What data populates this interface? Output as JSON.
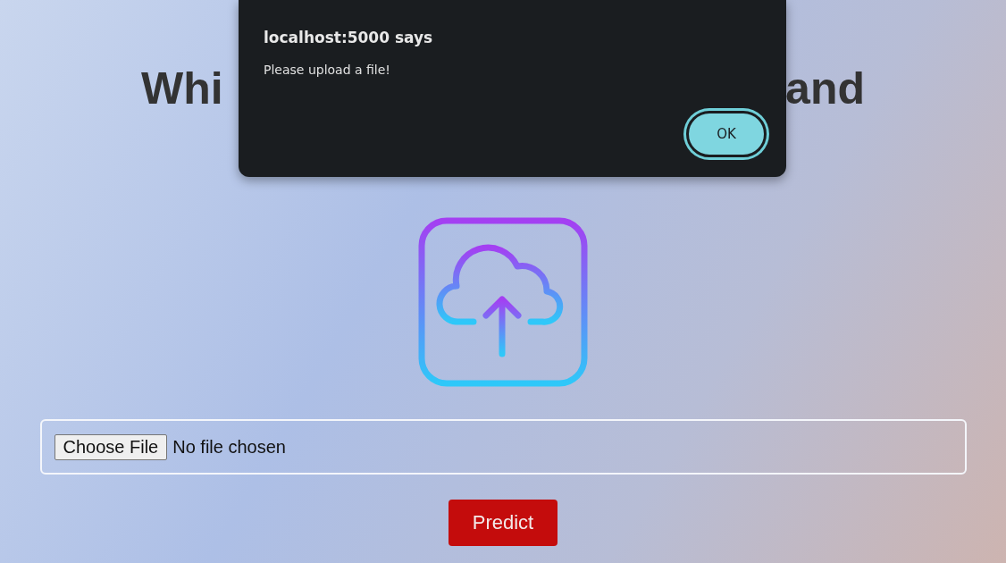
{
  "heading": {
    "left_part": "Whi",
    "right_part": "and"
  },
  "dialog": {
    "title": "localhost:5000 says",
    "message": "Please upload a file!",
    "ok_button": "OK"
  },
  "file_input": {
    "button": "Choose File",
    "status": "No file chosen"
  },
  "predict_button": "Predict"
}
